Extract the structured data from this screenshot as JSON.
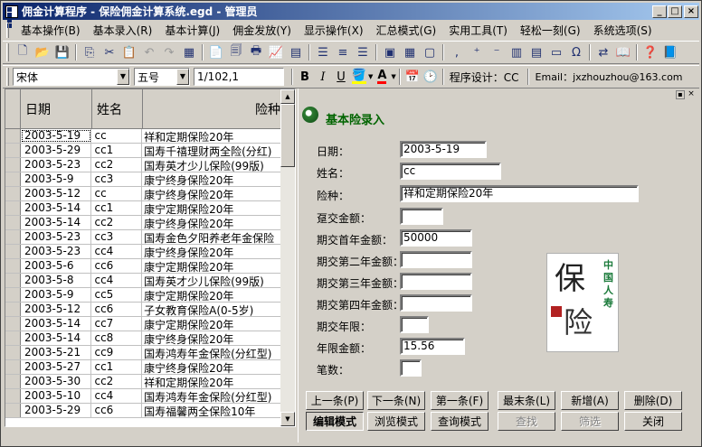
{
  "window": {
    "title": "佣金计算程序 - 保险佣金计算系统.egd - 管理员",
    "controls": [
      "_",
      "□",
      "×"
    ]
  },
  "menu": [
    "基本操作(B)",
    "基本录入(R)",
    "基本计算(J)",
    "佣金发放(Y)",
    "显示操作(X)",
    "汇总模式(G)",
    "实用工具(T)",
    "轻松一刻(G)",
    "系统选项(S)"
  ],
  "format": {
    "font": "宋体",
    "size": "五号",
    "cell": "1/102,1",
    "bold": "B",
    "italic": "I",
    "underline": "U",
    "designer": "程序设计：CC",
    "email": "Email：jxzhouzhou@163.com"
  },
  "grid": {
    "headers": [
      "日期",
      "姓名",
      "险种"
    ],
    "rows": [
      [
        "2003-5-19",
        "cc",
        "祥和定期保险20年"
      ],
      [
        "2003-5-29",
        "cc1",
        "国寿千禧理财两全险(分红)"
      ],
      [
        "2003-5-23",
        "cc2",
        "国寿英才少儿保险(99版)"
      ],
      [
        "2003-5-9",
        "cc3",
        "康宁终身保险20年"
      ],
      [
        "2003-5-12",
        "cc",
        "康宁终身保险20年"
      ],
      [
        "2003-5-14",
        "cc1",
        "康宁定期保险20年"
      ],
      [
        "2003-5-14",
        "cc2",
        "康宁终身保险20年"
      ],
      [
        "2003-5-23",
        "cc3",
        "国寿金色夕阳养老年金保险"
      ],
      [
        "2003-5-23",
        "cc4",
        "康宁终身保险20年"
      ],
      [
        "2003-5-6",
        "cc6",
        "康宁定期保险20年"
      ],
      [
        "2003-5-8",
        "cc4",
        "国寿英才少儿保险(99版)"
      ],
      [
        "2003-5-9",
        "cc5",
        "康宁定期保险20年"
      ],
      [
        "2003-5-12",
        "cc6",
        "子女教育保险A(0-5岁)"
      ],
      [
        "2003-5-14",
        "cc7",
        "康宁定期保险20年"
      ],
      [
        "2003-5-14",
        "cc8",
        "康宁终身保险20年"
      ],
      [
        "2003-5-21",
        "cc9",
        "国寿鸿寿年金保险(分红型)"
      ],
      [
        "2003-5-27",
        "cc1",
        "康宁终身保险20年"
      ],
      [
        "2003-5-30",
        "cc2",
        "祥和定期保险20年"
      ],
      [
        "2003-5-10",
        "cc4",
        "国寿鸿寿年金保险(分红型)"
      ],
      [
        "2003-5-29",
        "cc6",
        "国寿福馨两全保险10年"
      ]
    ]
  },
  "form": {
    "title": "基本险录入",
    "fields": [
      {
        "label": "日期：",
        "value": "2003-5-19"
      },
      {
        "label": "姓名：",
        "value": "cc"
      },
      {
        "label": "险种：",
        "value": "祥和定期保险20年"
      },
      {
        "label": "趸交金额：",
        "value": ""
      },
      {
        "label": "期交首年金额：",
        "value": "50000"
      },
      {
        "label": "期交第二年金额：",
        "value": ""
      },
      {
        "label": "期交第三年金额：",
        "value": ""
      },
      {
        "label": "期交第四年金额：",
        "value": ""
      },
      {
        "label": "期交年限：",
        "value": ""
      },
      {
        "label": "年限金额：",
        "value": "15.56"
      },
      {
        "label": "笔数：",
        "value": ""
      }
    ],
    "buttons_row1": [
      "上一条(P)",
      "下一条(N)",
      "第一条(F)",
      "最末条(L)",
      "新增(A)",
      "删除(D)"
    ],
    "buttons_row2": [
      "编辑模式",
      "浏览模式",
      "查询模式",
      "查找",
      "筛选",
      "关闭"
    ],
    "logo_text": [
      "中",
      "国",
      "人",
      "寿"
    ],
    "logo_glyphs": [
      "保",
      "险"
    ]
  }
}
